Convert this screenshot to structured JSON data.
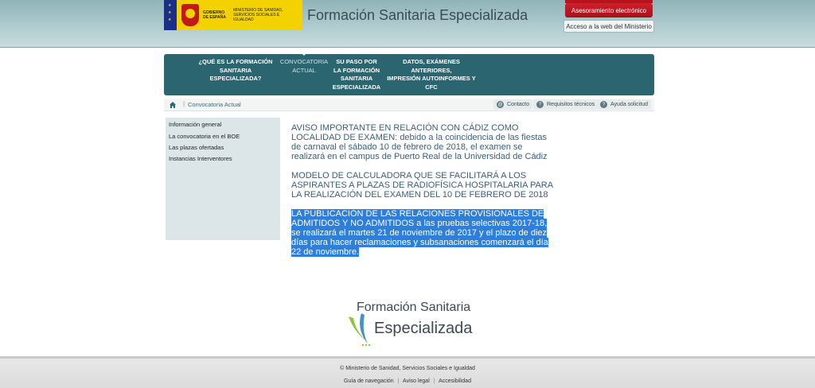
{
  "header": {
    "gov_text_1": "GOBIERNO DE ESPAÑA",
    "gov_text_2": "MINISTERIO DE SANIDAD, SERVICIOS SOCIALES E IGUALDAD",
    "site_title": "Formación Sanitaria Especializada",
    "btn_electronic": "Asesoramiento electrónico",
    "btn_ministry": "Acceso a la web del Ministerio"
  },
  "topnav": {
    "items": [
      {
        "label": "¿QUÉ ES LA FORMACIÓN\nSANITARIA ESPECIALIZADA?"
      },
      {
        "label": "CONVOCATORIA\nACTUAL"
      },
      {
        "label": "SU PASO POR\nLA FORMACIÓN\nSANITARIA\nESPECIALIZADA"
      },
      {
        "label": "DATOS, EXÁMENES ANTERIORES,\nIMPRESIÓN AUTOINFORMES Y CFC"
      }
    ]
  },
  "breadcrumb": {
    "current": "Convocatoria Actual"
  },
  "utility": {
    "contacto": "Contacto",
    "requisitos": "Requisitos técnicos",
    "ayuda": "Ayuda solicitud"
  },
  "leftmenu": {
    "items": [
      {
        "label": "Información general"
      },
      {
        "label": "La convocatoria en el BOE"
      },
      {
        "label": "Las plazas ofertadas"
      },
      {
        "label": "Instancias Interventores"
      }
    ]
  },
  "content": {
    "p1": "AVISO IMPORTANTE EN RELACIÓN CON CÁDIZ COMO LOCALIDAD DE EXAMEN: debido a la coincidencia de las fiestas de carnaval el sábado 10 de febrero de 2018, el examen se realizará en el campus de Puerto Real de la Universidad de Cádiz",
    "p2": "MODELO DE CALCULADORA QUE SE FACILITARÁ A LOS ASPIRANTES A PLAZAS DE RADIOFÍSICA HOSPITALARIA PARA LA REALIZACIÓN DEL EXAMEN DEL 10 DE FEBRERO DE 2018",
    "p3": "LA PUBLICACIÓN DE LAS RELACIONES PROVISIONALES DE ADMITIDOS Y NO ADMITIDOS a las pruebas selectivas 2017-18, se realizará el martes 21 de noviembre de 2017 y el plazo de diez días para hacer reclamaciones y subsanaciones comenzará el día 22 de noviembre."
  },
  "logo": {
    "line1": "Formación Sanitaria",
    "line2": "Especializada"
  },
  "footer": {
    "copyright": "© Ministerio de Sanidad, Servicios Sociales e Igualdad",
    "link1": "Guía de navegación",
    "link2": "Aviso legal",
    "link3": "Accesibilidad",
    "separator": "|"
  },
  "colors": {
    "nav_bg": "#2a6570",
    "highlight": "#2f7ed8",
    "brand_red": "#c21b17",
    "brand_yellow": "#f4d100"
  }
}
